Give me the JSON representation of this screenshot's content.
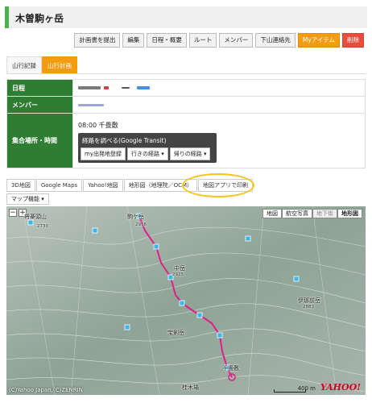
{
  "page_title": "木曽駒ヶ岳",
  "actions": [
    "計画書を提出",
    "編集",
    "日程・概要",
    "ルート",
    "メンバー",
    "下山連絡先",
    "Myアイテム",
    "削除"
  ],
  "subtabs": [
    "山行記録",
    "山行計画"
  ],
  "info": {
    "schedule_label": "日程",
    "member_label": "メンバー",
    "meeting_label": "集合場所・時間",
    "meeting_time": "08:00 千畳敷",
    "transit_title": "経路を調べる(Google Transit)",
    "transit_buttons": [
      "my出発地登録",
      "行きの経路 ▾",
      "帰りの経路 ▾"
    ]
  },
  "map_tabs": [
    "3D地図",
    "Google Maps",
    "Yahoo!地図",
    "地形図（地理院／OCM）",
    "地図アプリで印刷"
  ],
  "map_function": "マップ機能 ▾",
  "map": {
    "zoom_out": "−",
    "zoom_in": "+",
    "types": [
      "地図",
      "航空写真",
      "地下街",
      "地形図"
    ],
    "copyright": "(C)Yahoo Japan,(C)ZENRIN",
    "scale": "400 m",
    "logo": "YAHOO!",
    "places": [
      "将棊頭山",
      "駒ケ岳",
      "中岳",
      "宝剣岳",
      "伊那前岳",
      "千畳敷",
      "桂木場"
    ],
    "elevations": [
      "2730",
      "2956",
      "2925",
      "2883"
    ],
    "colors": {
      "route": "#e0208a",
      "marker": "#38b6e8"
    }
  },
  "colors": {
    "accent_green": "#2e7d32",
    "orange": "#f39c12",
    "red": "#e74c3c",
    "highlight": "#f5c518"
  }
}
